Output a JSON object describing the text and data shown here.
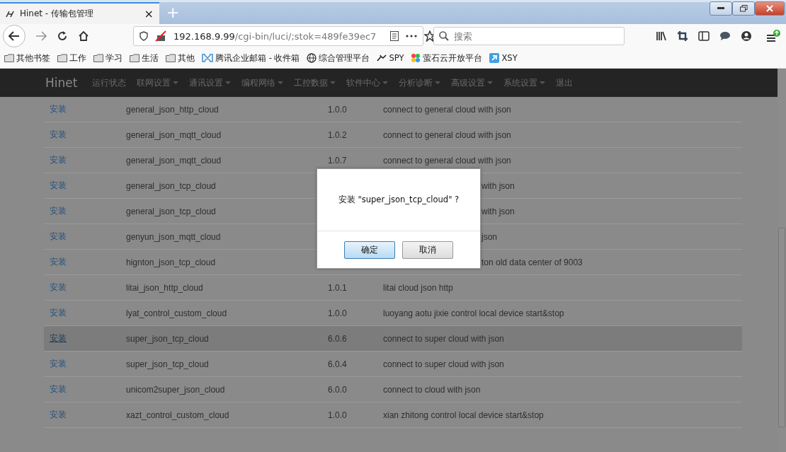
{
  "browser": {
    "tab": {
      "title": "Hinet - 传输包管理",
      "close": "×"
    },
    "new_tab": "+",
    "url": {
      "host": "192.168.9.99",
      "path": "/cgi-bin/luci/;stok=489fe39ec7"
    },
    "search": {
      "placeholder": "搜索"
    },
    "bookmarks": [
      {
        "label": "其他书签",
        "kind": "folder"
      },
      {
        "label": "工作",
        "kind": "folder"
      },
      {
        "label": "学习",
        "kind": "folder"
      },
      {
        "label": "生活",
        "kind": "folder"
      },
      {
        "label": "其他",
        "kind": "folder"
      },
      {
        "label": "腾讯企业邮箱 - 收件箱",
        "kind": "mail"
      },
      {
        "label": "综合管理平台",
        "kind": "globe"
      },
      {
        "label": "SPY",
        "kind": "bird"
      },
      {
        "label": "萤石云开放平台",
        "kind": "flower"
      },
      {
        "label": "XSY",
        "kind": "arrow"
      }
    ]
  },
  "nav": {
    "brand": "Hinet",
    "items": [
      {
        "label": "运行状态",
        "dropdown": false
      },
      {
        "label": "联网设置",
        "dropdown": true
      },
      {
        "label": "通讯设置",
        "dropdown": true
      },
      {
        "label": "编程网络",
        "dropdown": true
      },
      {
        "label": "工控数据",
        "dropdown": true
      },
      {
        "label": "软件中心",
        "dropdown": true
      },
      {
        "label": "分析诊断",
        "dropdown": true
      },
      {
        "label": "高级设置",
        "dropdown": true
      },
      {
        "label": "系统设置",
        "dropdown": true
      },
      {
        "label": "退出",
        "dropdown": false
      }
    ]
  },
  "table": {
    "rows": [
      {
        "action": "安装",
        "name": "general_json_http_cloud",
        "version": "1.0.0",
        "description": "connect to general cloud with json",
        "selected": false
      },
      {
        "action": "安装",
        "name": "general_json_mqtt_cloud",
        "version": "1.0.2",
        "description": "connect to general cloud with json",
        "selected": false
      },
      {
        "action": "安装",
        "name": "general_json_mqtt_cloud",
        "version": "1.0.7",
        "description": "connect to general cloud with json",
        "selected": false
      },
      {
        "action": "安装",
        "name": "general_json_tcp_cloud",
        "description": "with json",
        "selected": false
      },
      {
        "action": "安装",
        "name": "general_json_tcp_cloud",
        "description": "with json",
        "selected": false
      },
      {
        "action": "安装",
        "name": "genyun_json_mqtt_cloud",
        "description": "json",
        "selected": false
      },
      {
        "action": "安装",
        "name": "hignton_json_tcp_cloud",
        "description": "ton old data center of 9003",
        "selected": false
      },
      {
        "action": "安装",
        "name": "litai_json_http_cloud",
        "version": "1.0.1",
        "description": "litai cloud json http",
        "selected": false
      },
      {
        "action": "安装",
        "name": "lyat_control_custom_cloud",
        "version": "1.0.0",
        "description": "luoyang aotu jixie control local device start&stop",
        "selected": false
      },
      {
        "action": "安装",
        "name": "super_json_tcp_cloud",
        "version": "6.0.6",
        "description": "connect to super cloud with json",
        "selected": true
      },
      {
        "action": "安装",
        "name": "super_json_tcp_cloud",
        "version": "6.0.4",
        "description": "connect to super cloud with json",
        "selected": false
      },
      {
        "action": "安装",
        "name": "unicom2super_json_cloud",
        "version": "6.0.0",
        "description": "connect to cloud with json",
        "selected": false
      },
      {
        "action": "安装",
        "name": "xazt_control_custom_cloud",
        "version": "1.0.0",
        "description": "xian zhitong control local device start&stop",
        "selected": false
      }
    ]
  },
  "dialog": {
    "message": "安装 \"super_json_tcp_cloud\" ?",
    "buttons": [
      {
        "label": "确定",
        "selected": true
      },
      {
        "label": "取消",
        "selected": false
      }
    ]
  }
}
